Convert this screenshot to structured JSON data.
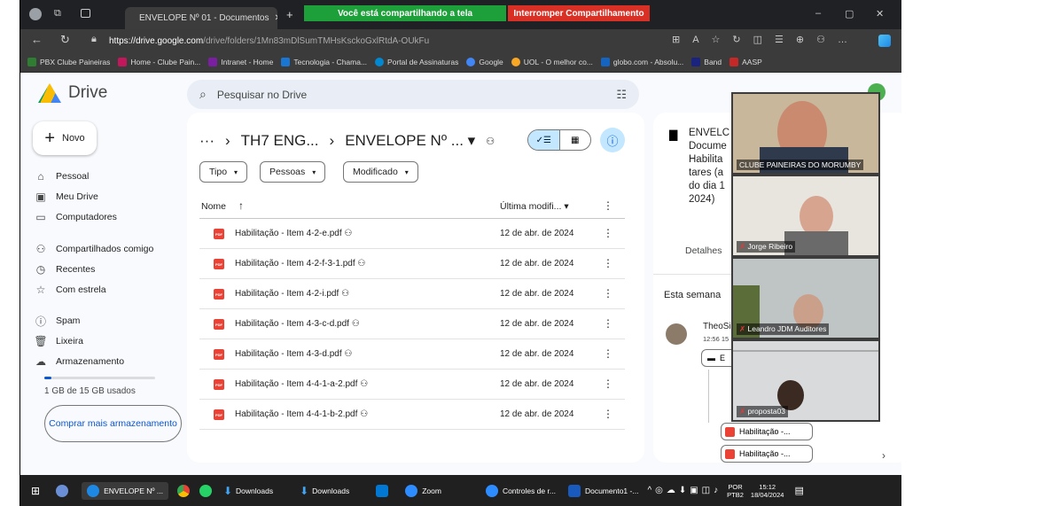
{
  "browser": {
    "tab_title": "ENVELOPE Nº 01 - Documentos",
    "sharing_text": "Você está compartilhando a tela",
    "stop_sharing": "Interromper Compartilhamento",
    "url_host": "https://drive.google.com",
    "url_path": "/drive/folders/1Mn83mDlSumTMHsKsckoGxlRtdA-OUkFu",
    "new_tab": "+",
    "min": "–",
    "max": "▢",
    "close": "✕"
  },
  "bookmarks": [
    {
      "label": "PBX Clube Paineiras",
      "color": "#2e7d32"
    },
    {
      "label": "Home - Clube Pain...",
      "color": "#c2185b"
    },
    {
      "label": "Intranet - Home",
      "color": "#7b1fa2"
    },
    {
      "label": "Tecnologia - Chama...",
      "color": "#1976d2"
    },
    {
      "label": "Portal de Assinaturas",
      "color": "#0288d1"
    },
    {
      "label": "Google",
      "color": "#4285f4"
    },
    {
      "label": "UOL - O melhor co...",
      "color": "#f9a825"
    },
    {
      "label": "globo.com - Absolu...",
      "color": "#1565c0"
    },
    {
      "label": "Band",
      "color": "#1a237e"
    },
    {
      "label": "AASP",
      "color": "#c62828"
    }
  ],
  "drive": {
    "logo": "Drive",
    "search_placeholder": "Pesquisar no Drive",
    "new_label": "Novo",
    "nav": [
      {
        "label": "Pessoal",
        "icon": "⌂"
      },
      {
        "label": "Meu Drive",
        "icon": "▣"
      },
      {
        "label": "Computadores",
        "icon": "▭"
      },
      {
        "label": "Compartilhados comigo",
        "icon": "⚇"
      },
      {
        "label": "Recentes",
        "icon": "◷"
      },
      {
        "label": "Com estrela",
        "icon": "☆"
      },
      {
        "label": "Spam",
        "icon": "ⓘ"
      },
      {
        "label": "Lixeira",
        "icon": "🗑"
      },
      {
        "label": "Armazenamento",
        "icon": "☁"
      }
    ],
    "storage_text": "1 GB de 15 GB usados",
    "storage_fraction": 0.067,
    "buy_label": "Comprar mais armazenamento",
    "breadcrumb": [
      "···",
      "TH7 ENG...",
      "ENVELOPE Nº ... ▾"
    ],
    "filters": [
      "Tipo",
      "Pessoas",
      "Modificado"
    ],
    "col_name": "Nome",
    "col_modified": "Última modifi...",
    "files": [
      {
        "name": "Habilitação - Item 4-2-e.pdf",
        "date": "12 de abr. de 2024"
      },
      {
        "name": "Habilitação - Item 4-2-f-3-1.pdf",
        "date": "12 de abr. de 2024"
      },
      {
        "name": "Habilitação - Item 4-2-i.pdf",
        "date": "12 de abr. de 2024"
      },
      {
        "name": "Habilitação - Item 4-3-c-d.pdf",
        "date": "12 de abr. de 2024"
      },
      {
        "name": "Habilitação - Item 4-3-d.pdf",
        "date": "12 de abr. de 2024"
      },
      {
        "name": "Habilitação - Item 4-4-1-a-2.pdf",
        "date": "12 de abr. de 2024"
      },
      {
        "name": "Habilitação - Item 4-4-1-b-2.pdf",
        "date": "12 de abr. de 2024"
      }
    ]
  },
  "detail": {
    "title_lines": [
      "ENVELC",
      "Docume",
      "Habilita",
      "tares (a",
      "do dia 1",
      "2024)"
    ],
    "tab_details": "Detalhes",
    "week": "Esta semana",
    "actor": "TheoSi",
    "time": "12:56 15",
    "folder_chip": "E",
    "file_chip_1": "Habilitação -...",
    "file_chip_2": "Habilitação -..."
  },
  "zoom": [
    {
      "label": "CLUBE PAINEIRAS DO MORUMBY"
    },
    {
      "label": "Jorge Ribeiro"
    },
    {
      "label": "Leandro JDM Auditores"
    },
    {
      "label": "proposta03"
    }
  ],
  "taskbar": {
    "items": [
      {
        "label": "ENVELOPE Nº ...",
        "color": "#1e88e5"
      },
      {
        "label": "Downloads",
        "color": "#1e88e5"
      },
      {
        "label": "Downloads",
        "color": "#1e88e5"
      },
      {
        "label": "Zoom",
        "color": "#2d8cff"
      },
      {
        "label": "Controles de r...",
        "color": "#2d8cff"
      },
      {
        "label": "Documento1 -...",
        "color": "#185abd"
      }
    ],
    "lang": "POR",
    "lang_sub": "PTB2",
    "time": "15:12",
    "date": "18/04/2024"
  }
}
